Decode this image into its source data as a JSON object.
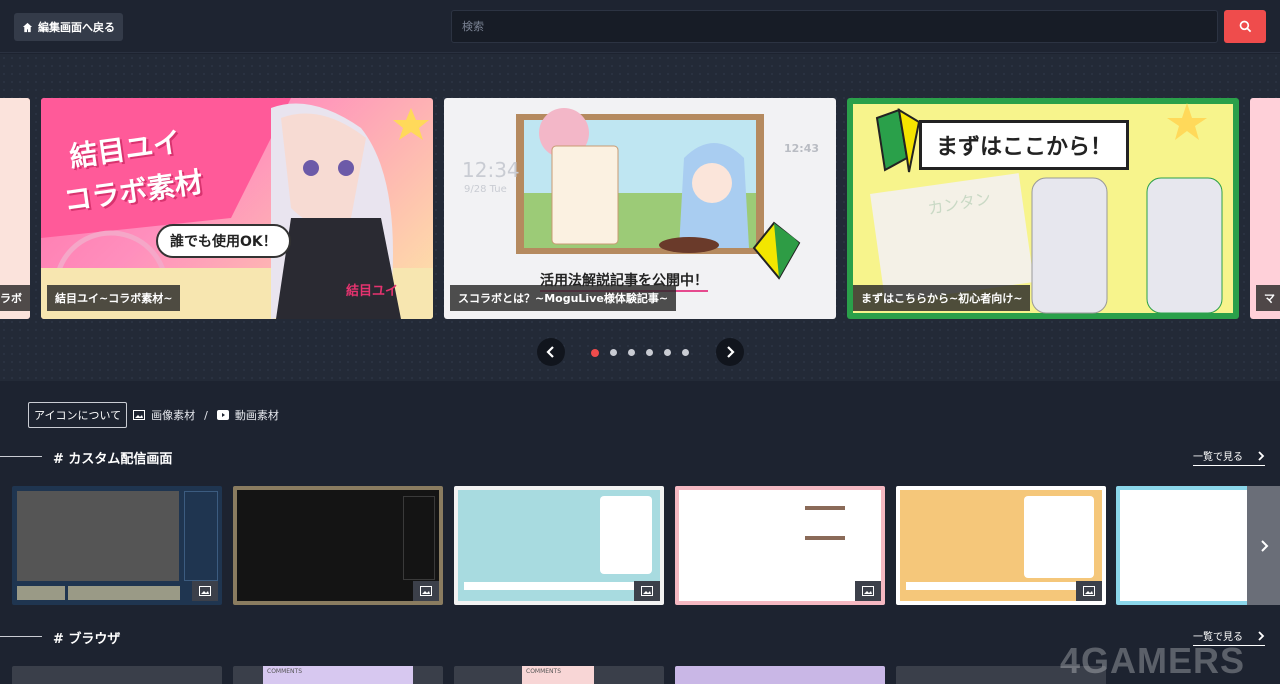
{
  "header": {
    "back_label": "編集画面へ戻る",
    "search_placeholder": "検索"
  },
  "carousel": {
    "slides": [
      {
        "caption": "ラボ"
      },
      {
        "caption": "結目ユイ~コラボ素材~",
        "art_title_1": "結目ユイ",
        "art_title_2": "コラボ素材",
        "bubble": "誰でも使用OK！",
        "stamp": "結目ユイ"
      },
      {
        "caption": "スコラボとは？~MoguLive様体験記事~",
        "art_banner": "活用法解説記事を公開中！",
        "clock_a": "12:34",
        "clock_b": "12:43",
        "date": "9/28 Tue"
      },
      {
        "caption": "まずはこちらから~初心者向け~",
        "art_banner": "まずはここから！",
        "watermark_word": "カンタン"
      },
      {
        "caption": "マ"
      }
    ],
    "dot_count": 6,
    "active_dot": 0
  },
  "icon_legend": {
    "about_label": "アイコンについて",
    "image_label": "画像素材",
    "separator": "/",
    "video_label": "動画素材"
  },
  "sections": [
    {
      "title": "# カスタム配信画面",
      "see_all": "一覧で見る"
    },
    {
      "title": "# ブラウザ",
      "see_all": "一覧で見る"
    }
  ],
  "browser_labels": [
    "COMMENTS",
    "COMMENTS"
  ],
  "watermark": "4GAMERS",
  "colors": {
    "accent": "#ef4c4c",
    "background": "#1d2330"
  }
}
